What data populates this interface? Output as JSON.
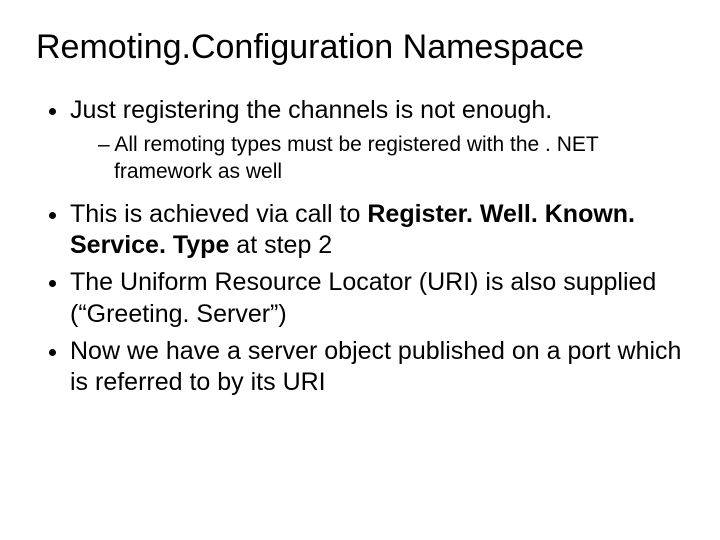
{
  "title": "Remoting.Configuration Namespace",
  "bullets": {
    "b1": "Just registering the channels is not enough.",
    "b1_sub1": "All remoting types must be registered with the . NET framework as well",
    "b2_pre": "This is achieved via call to ",
    "b2_bold": "Register. Well. Known. Service. Type",
    "b2_post": " at step 2",
    "b3": "The Uniform Resource Locator (URI) is also supplied (“Greeting. Server”)",
    "b4": "Now we have a server object published on a port which is referred to by its URI"
  }
}
